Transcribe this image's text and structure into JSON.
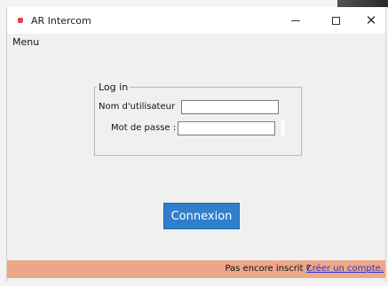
{
  "window": {
    "title": "AR Intercom",
    "controls": {
      "minimize_icon": "minimize-icon",
      "maximize_icon": "maximize-icon",
      "close_glyph": "✕"
    }
  },
  "menubar": {
    "items": [
      "Menu"
    ]
  },
  "login": {
    "legend": "Log in",
    "username_label": "Nom d'utilisateur",
    "username_value": "",
    "password_label": "Mot de passe :",
    "password_value": ""
  },
  "actions": {
    "connect_label": "Connexion"
  },
  "footer": {
    "prompt": "Pas encore inscrit ?",
    "link_label": "Créer un compte."
  },
  "colors": {
    "accent_button": "#2f7fcb",
    "footer_bg": "#eba788",
    "link": "#2a34d0",
    "app_icon": "#e1433e"
  }
}
